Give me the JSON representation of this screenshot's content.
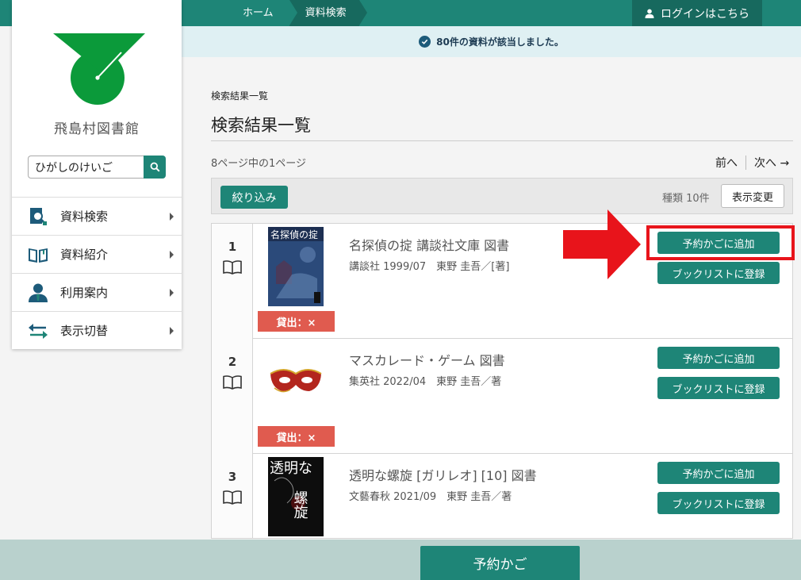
{
  "breadcrumb": {
    "home": "ホーム",
    "current": "資料検索"
  },
  "header": {
    "login_label": "ログインはこちら"
  },
  "notice": {
    "text": "80件の資料が該当しました。"
  },
  "sidebar": {
    "library_name": "飛島村図書館",
    "search_value": "ひがしのけいご",
    "items": [
      {
        "label": "資料検索",
        "icon": "search-document-icon"
      },
      {
        "label": "資料紹介",
        "icon": "open-book-icon"
      },
      {
        "label": "利用案内",
        "icon": "user-info-icon"
      },
      {
        "label": "表示切替",
        "icon": "swap-arrows-icon"
      }
    ]
  },
  "main": {
    "small_title": "検索結果一覧",
    "title": "検索結果一覧",
    "page_info": "8ページ中の1ページ",
    "prev_label": "前へ",
    "next_label": "次へ →",
    "filter_label": "絞り込み",
    "type_count": "種類 10件",
    "display_change_label": "表示変更"
  },
  "results": [
    {
      "num": "1",
      "title": "名探偵の掟 講談社文庫 図書",
      "meta": "講談社 1999/07　東野 圭吾／[著]",
      "status": "貸出：×",
      "cart_label": "予約かごに追加",
      "list_label": "ブックリストに登録",
      "cover_text": "名探偵の掟"
    },
    {
      "num": "2",
      "title": "マスカレード・ゲーム 図書",
      "meta": "集英社 2022/04　東野 圭吾／著",
      "status": "貸出：×",
      "cart_label": "予約かごに追加",
      "list_label": "ブックリストに登録"
    },
    {
      "num": "3",
      "title": "透明な螺旋 [ガリレオ] [10] 図書",
      "meta": "文藝春秋 2021/09　東野 圭吾／著",
      "cart_label": "予約かごに追加",
      "list_label": "ブックリストに登録",
      "cover_text_1": "透明な",
      "cover_text_2": "螺旋"
    }
  ],
  "footer": {
    "cart_label": "予約かご"
  },
  "colors": {
    "accent": "#1e8577",
    "accent_dark": "#17695e",
    "status_red": "#e05b4f",
    "annotation_red": "#e8141b",
    "logo_green": "#0b9a3a"
  }
}
